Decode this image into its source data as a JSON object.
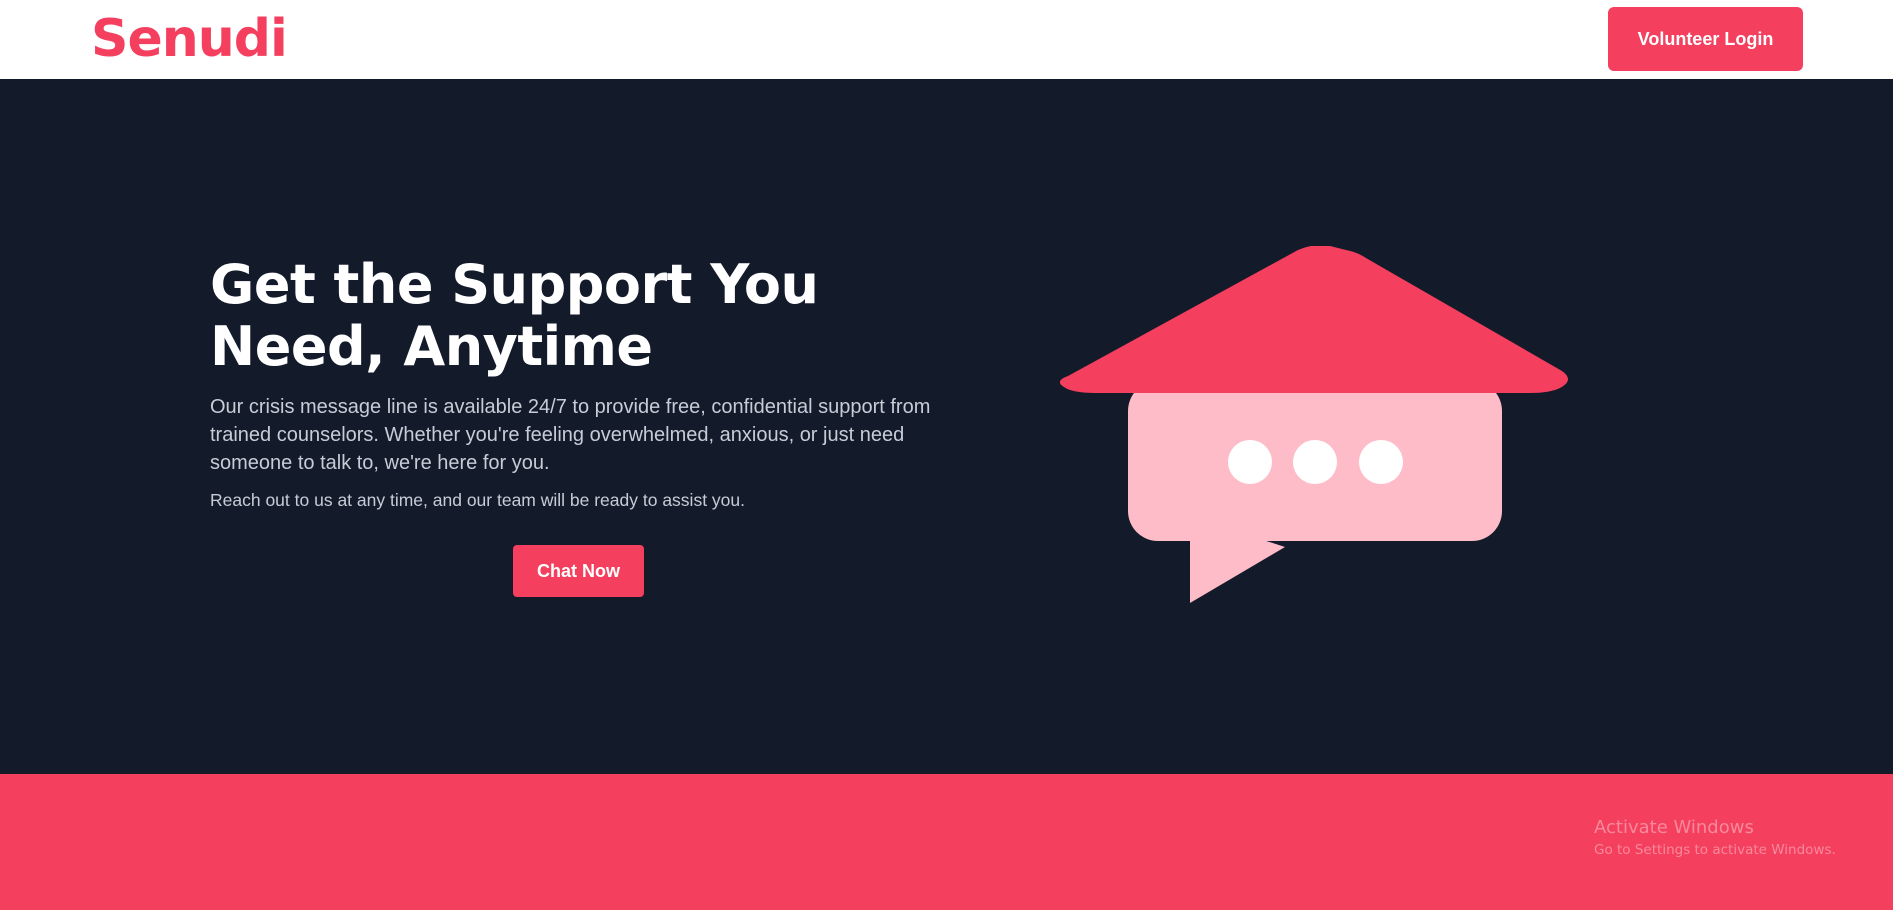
{
  "header": {
    "logo_text": "Senudi",
    "login_label": "Volunteer Login"
  },
  "hero": {
    "title": "Get the Support You Need, Anytime",
    "description": "Our crisis message line is available 24/7 to provide free, confidential support from trained counselors. Whether you're feeling overwhelmed, anxious, or just need someone to talk to, we're here for you.",
    "note": "Reach out to us at any time, and our team will be ready to assist you.",
    "cta_label": "Chat Now",
    "illustration_icon": "house-chat-bubble-icon"
  },
  "watermark": {
    "title": "Activate Windows",
    "subtitle": "Go to Settings to activate Windows."
  },
  "colors": {
    "accent": "#f43f5e",
    "hero_background": "#131a2a",
    "bubble_fill": "#fdbcc8",
    "header_background": "#ffffff"
  }
}
